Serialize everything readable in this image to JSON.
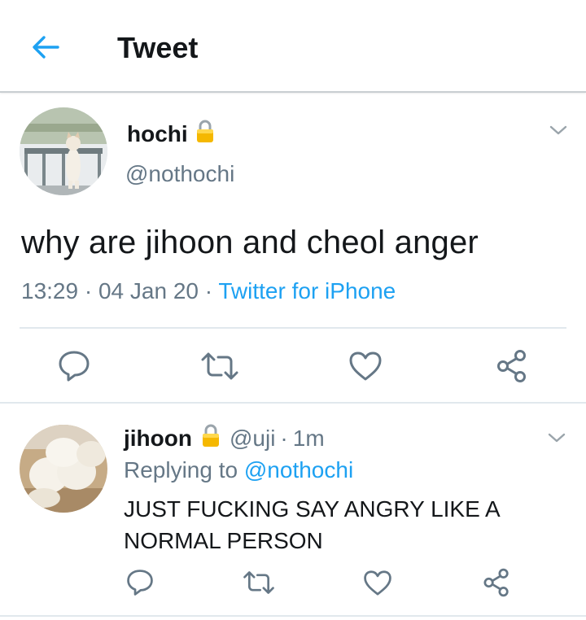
{
  "header": {
    "title": "Tweet",
    "back_icon": "arrow-left-icon"
  },
  "colors": {
    "accent": "#1da1f2",
    "muted": "#657786",
    "text": "#14171a",
    "divider": "#e1e8ed"
  },
  "main_tweet": {
    "name": "hochi",
    "handle": "@nothochi",
    "protected_icon": "lock-icon",
    "text": "why are jihoon and cheol anger",
    "time": "13:29",
    "date": "04 Jan 20",
    "source": "Twitter for iPhone",
    "separator": "·",
    "actions": [
      "reply-icon",
      "retweet-icon",
      "like-icon",
      "share-icon"
    ]
  },
  "reply_tweet": {
    "name": "jihoon",
    "handle": "@uji",
    "separator": "·",
    "time": "1m",
    "replying_label": "Replying to",
    "replying_to": "@nothochi",
    "text": "JUST FUCKING SAY ANGRY LIKE A NORMAL PERSON",
    "actions": [
      "reply-icon",
      "retweet-icon",
      "like-icon",
      "share-icon"
    ]
  }
}
